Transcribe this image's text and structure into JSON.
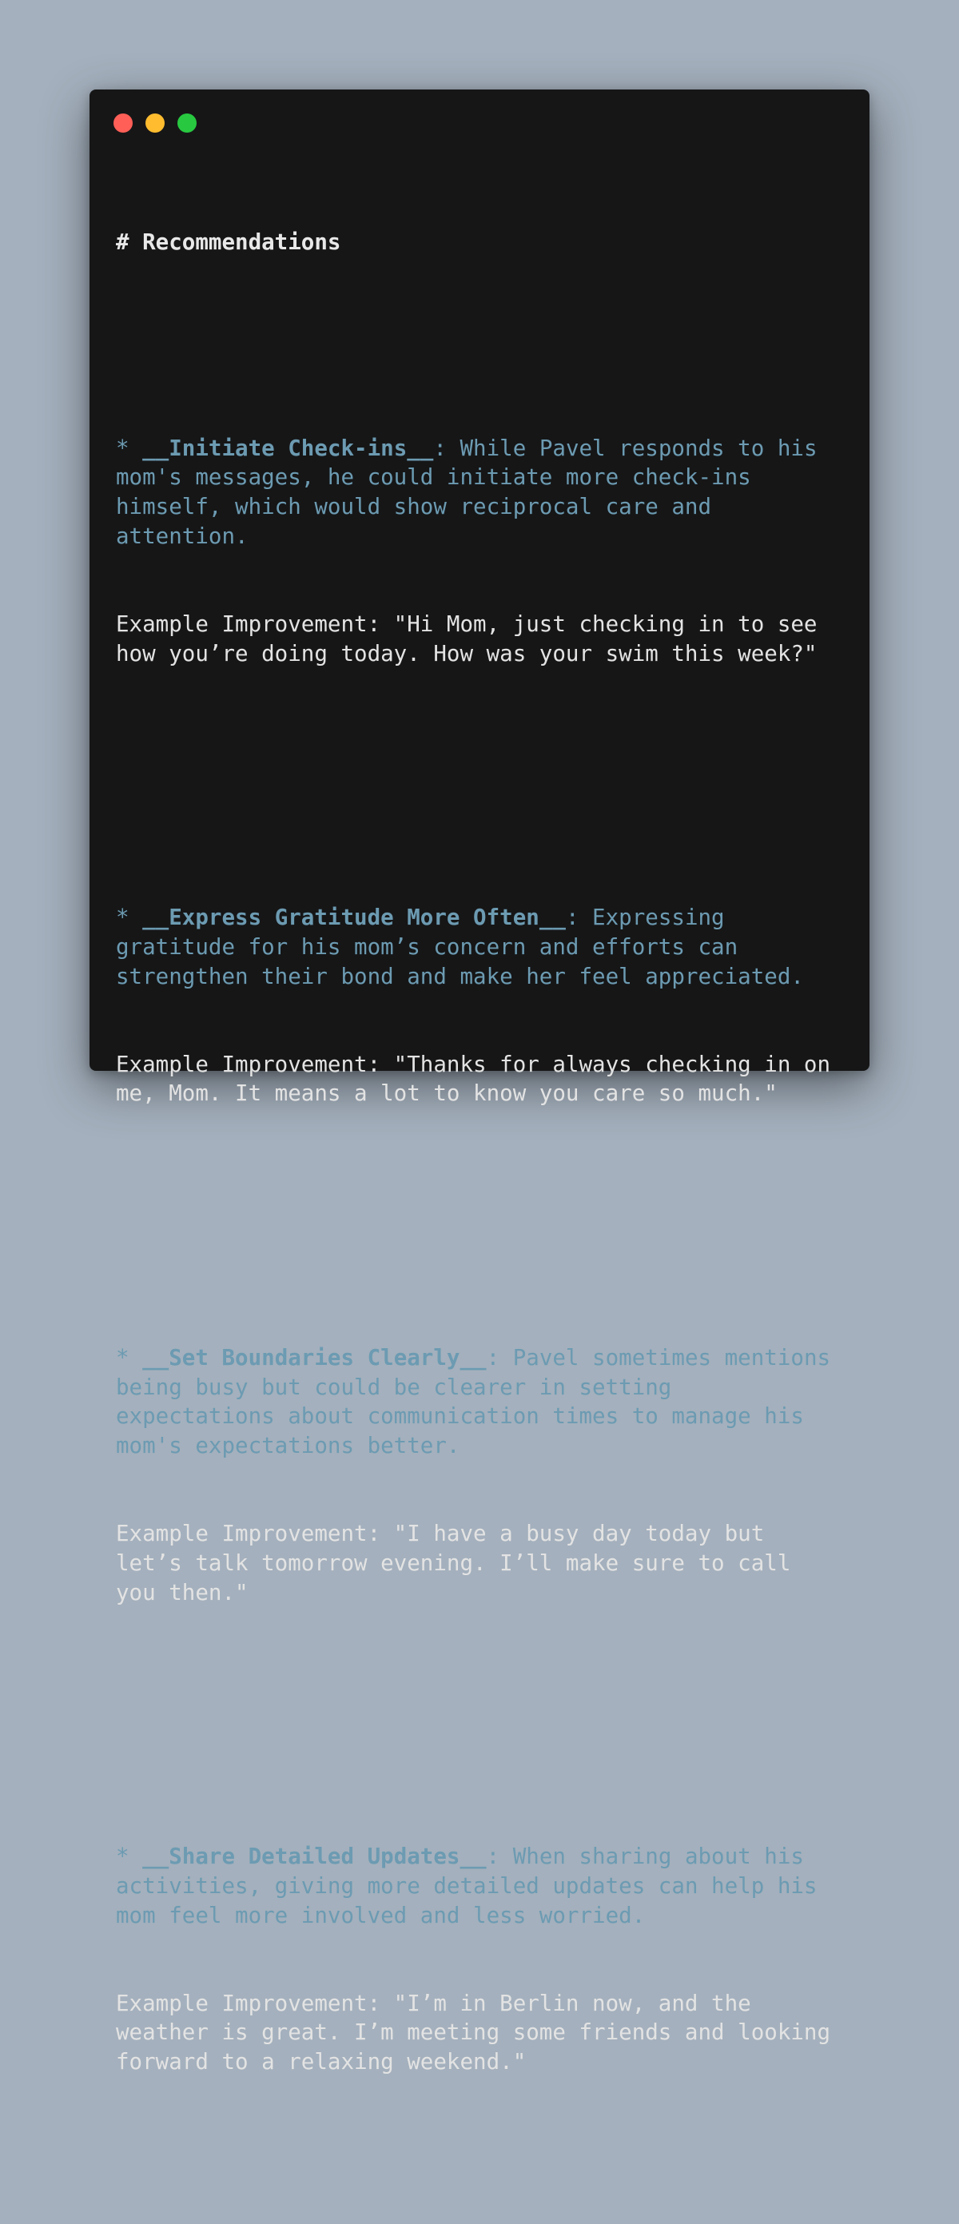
{
  "window": {
    "controls": [
      {
        "name": "close",
        "color": "#ff5f57"
      },
      {
        "name": "minimize",
        "color": "#febc2e"
      },
      {
        "name": "zoom",
        "color": "#28c840"
      }
    ]
  },
  "document": {
    "heading": "# Recommendations",
    "recommendations": [
      {
        "bullet": "* ",
        "title": "__Initiate Check-ins__",
        "description": ": While Pavel responds to his mom's messages, he could initiate more check-ins himself, which would show reciprocal care and attention.",
        "example": "Example Improvement: \"Hi Mom, just checking in to see how you’re doing today. How was your swim this week?\""
      },
      {
        "bullet": "* ",
        "title": "__Express Gratitude More Often__",
        "description": ": Expressing gratitude for his mom’s concern and efforts can strengthen their bond and make her feel appreciated.",
        "example": "Example Improvement: \"Thanks for always checking in on me, Mom. It means a lot to know you care so much.\""
      },
      {
        "bullet": "* ",
        "title": "__Set Boundaries Clearly__",
        "description": ": Pavel sometimes mentions being busy but could be clearer in setting expectations about communication times to manage his mom's expectations better.",
        "example": "Example Improvement: \"I have a busy day today but let’s talk tomorrow evening. I’ll make sure to call you then.\""
      },
      {
        "bullet": "* ",
        "title": "__Share Detailed Updates__",
        "description": ": When sharing about his activities, giving more detailed updates can help his mom feel more involved and less worried.",
        "example": "Example Improvement: \"I’m in Berlin now, and the weather is great. I’m meeting some friends and looking forward to a relaxing weekend.\""
      }
    ]
  },
  "colors": {
    "background": "#a4b0bd",
    "window": "#161617",
    "accent_text": "#6c9bb2",
    "body_text": "#e3e3e3"
  }
}
